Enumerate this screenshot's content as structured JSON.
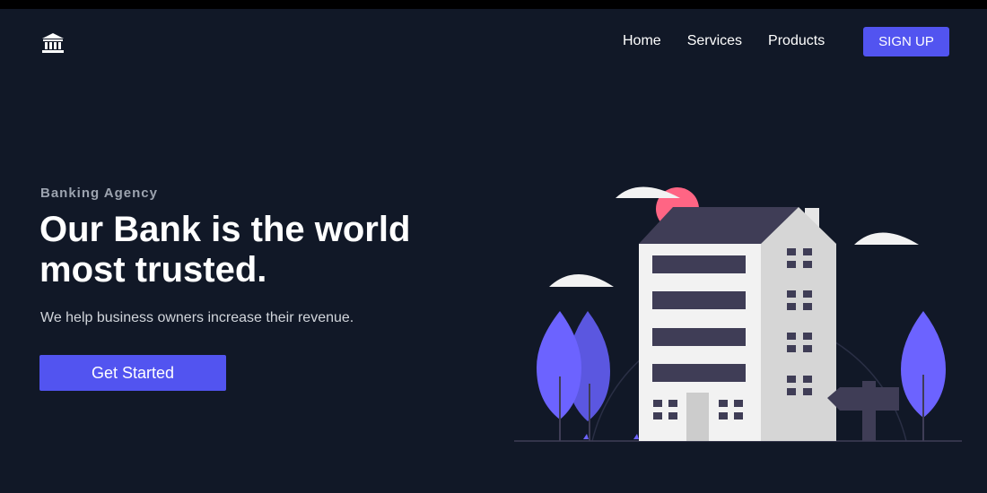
{
  "nav": {
    "logo_icon": "bank-icon",
    "items": [
      "Home",
      "Services",
      "Products"
    ],
    "signup_label": "SIGN UP"
  },
  "hero": {
    "eyebrow": "Banking Agency",
    "headline_line1": "Our Bank is the world",
    "headline_line2": "most trusted.",
    "subtext": "We help business owners increase their revenue.",
    "cta_label": "Get Started"
  },
  "colors": {
    "background": "#111827",
    "accent": "#5254f0",
    "building_dark": "#3f3d56",
    "tree": "#6c63ff",
    "sun": "#ff6584"
  }
}
